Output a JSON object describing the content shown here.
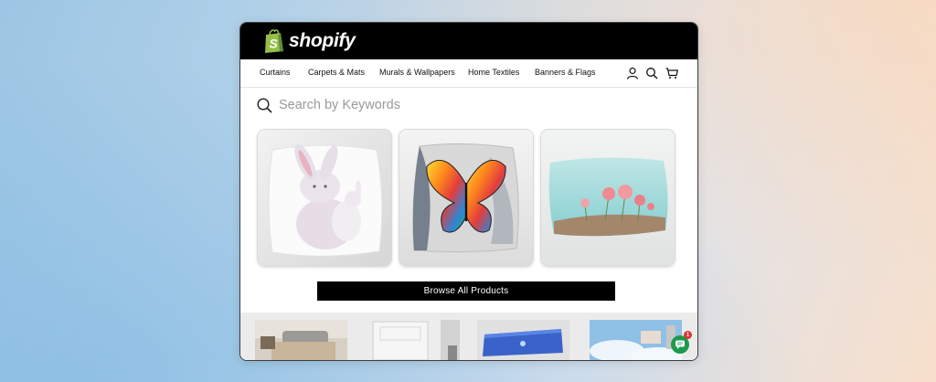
{
  "brand": {
    "name": "shopify",
    "logo_icon": "shopify-bag-icon",
    "accent": "#95bf47"
  },
  "nav": {
    "items": [
      "Curtains",
      "Carpets & Mats",
      "Murals & Wallpapers",
      "Home Textiles",
      "Banners & Flags"
    ],
    "icons": [
      "user-icon",
      "search-icon",
      "cart-icon"
    ]
  },
  "search": {
    "placeholder": "Search by Keywords"
  },
  "products": [
    {
      "image": "bunny-pillow"
    },
    {
      "image": "rainbow-butterfly-pillow"
    },
    {
      "image": "poppy-flower-pillow"
    }
  ],
  "browse_button": {
    "label": "Browse All Products"
  },
  "category_thumbnails": [
    "sofa-room-carpet",
    "door-curtain",
    "blue-banner",
    "sky-mural"
  ],
  "chat": {
    "icon": "chat-icon",
    "badge": "1",
    "color": "#1d9a4b"
  }
}
